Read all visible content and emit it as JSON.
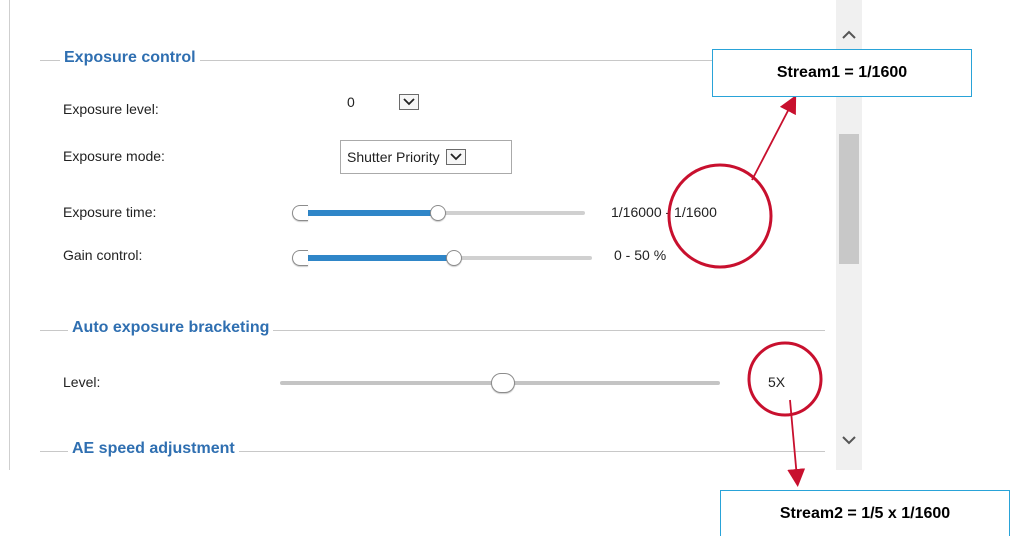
{
  "sections": {
    "exposure_control": "Exposure control",
    "auto_exposure_bracketing": "Auto exposure bracketing",
    "ae_speed_adjustment": "AE speed adjustment"
  },
  "exposure": {
    "level_label": "Exposure level:",
    "level_value": "0",
    "mode_label": "Exposure mode:",
    "mode_value": "Shutter Priority",
    "time_label": "Exposure time:",
    "time_range": "1/16000 - 1/1600",
    "gain_label": "Gain control:",
    "gain_range": "0 - 50 %"
  },
  "bracketing": {
    "level_label": "Level:",
    "level_value": "5X"
  },
  "callouts": {
    "stream1": "Stream1 = 1/1600",
    "stream2": "Stream2 = 1/5 x 1/1600"
  },
  "icons": {
    "dropdown": "chevron-down-icon",
    "scroll_up": "chevron-up-icon",
    "scroll_down": "chevron-down-icon"
  },
  "colors": {
    "section_title": "#2f6fb1",
    "slider_fill": "#2f86c8",
    "annotation": "#c8102e",
    "callout_border": "#29a3d8"
  }
}
